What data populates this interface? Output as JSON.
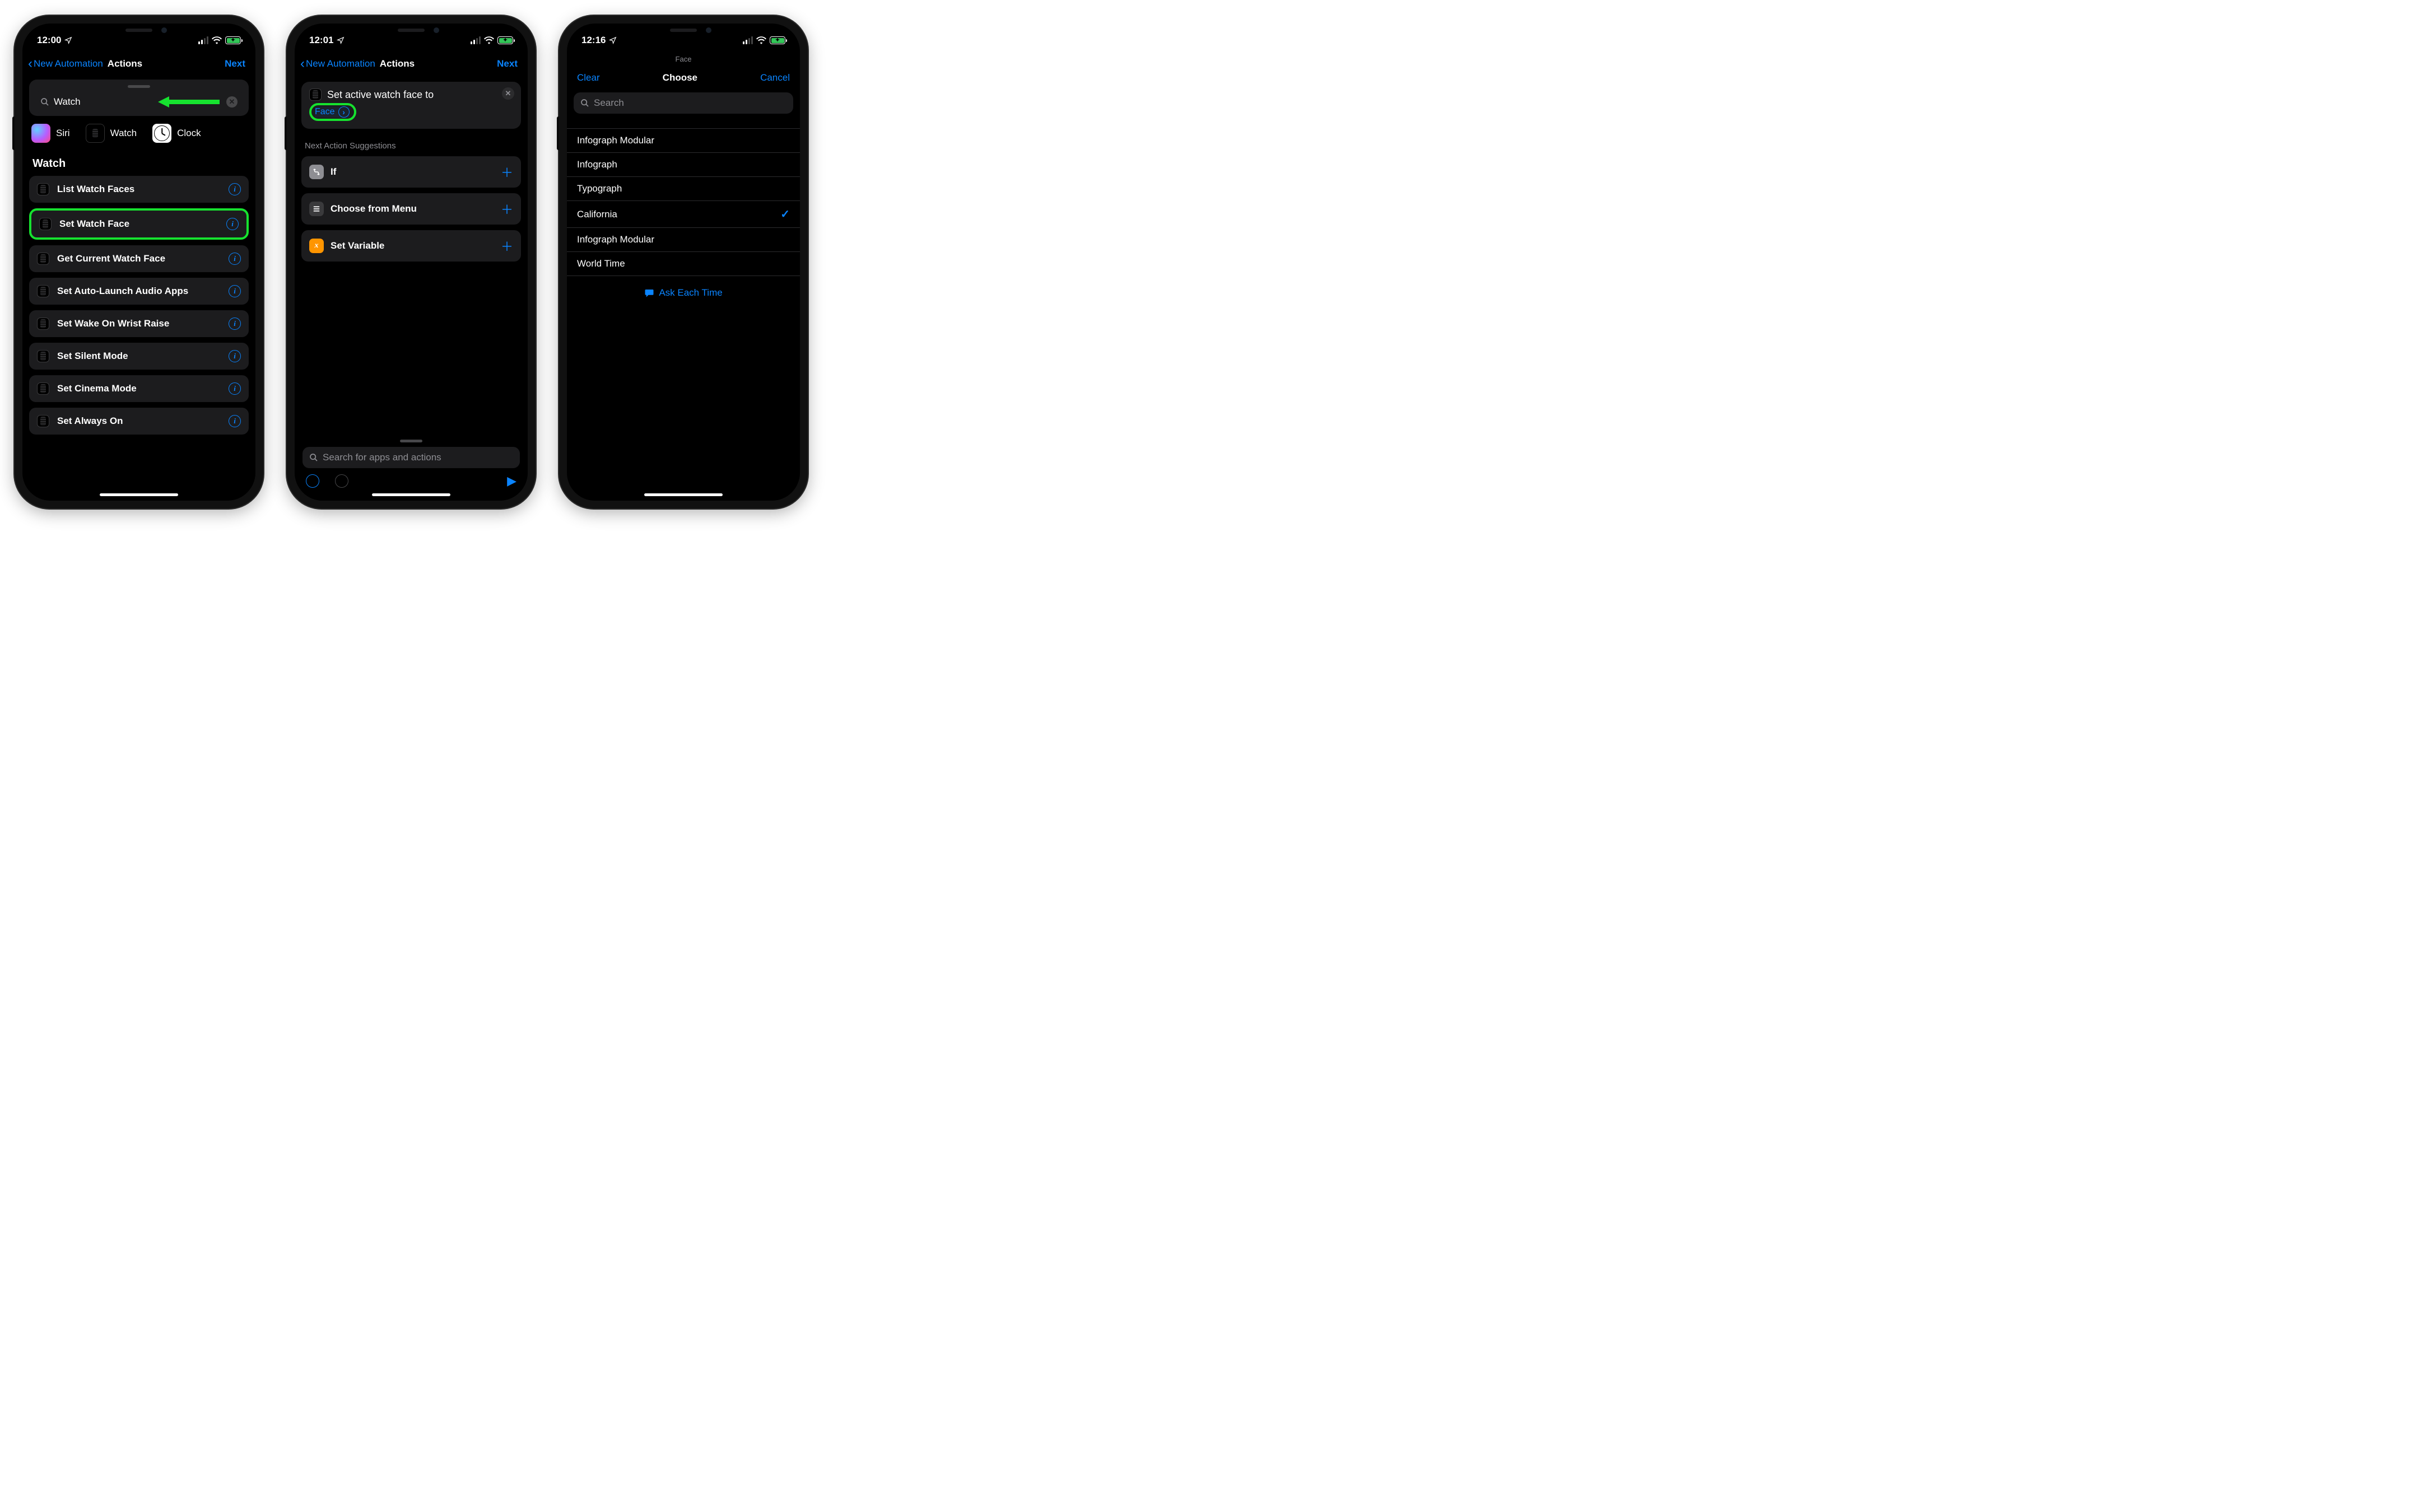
{
  "accent": "#0a84ff",
  "highlight": "#16e22f",
  "phone1": {
    "status": {
      "time": "12:00"
    },
    "nav": {
      "back": "New Automation",
      "title": "Actions",
      "next": "Next"
    },
    "search": {
      "value": "Watch"
    },
    "apps": {
      "siri": "Siri",
      "watch": "Watch",
      "clock": "Clock"
    },
    "section": "Watch",
    "actions": [
      "List Watch Faces",
      "Set Watch Face",
      "Get Current Watch Face",
      "Set Auto-Launch Audio Apps",
      "Set Wake On Wrist Raise",
      "Set Silent Mode",
      "Set Cinema Mode",
      "Set Always On"
    ]
  },
  "phone2": {
    "status": {
      "time": "12:01"
    },
    "nav": {
      "back": "New Automation",
      "title": "Actions",
      "next": "Next"
    },
    "tokenPrefix": "Set active watch face to",
    "tokenParam": "Face",
    "suggTitle": "Next Action Suggestions",
    "suggestions": [
      "If",
      "Choose from Menu",
      "Set Variable"
    ],
    "searchPlaceholder": "Search for apps and actions"
  },
  "phone3": {
    "status": {
      "time": "12:16"
    },
    "miniTitle": "Face",
    "picker": {
      "clear": "Clear",
      "title": "Choose",
      "cancel": "Cancel"
    },
    "searchPlaceholder": "Search",
    "faces": [
      "Infograph Modular",
      "Infograph",
      "Typograph",
      "California",
      "Infograph Modular",
      "World Time"
    ],
    "selectedIndex": 3,
    "ask": "Ask Each Time"
  }
}
